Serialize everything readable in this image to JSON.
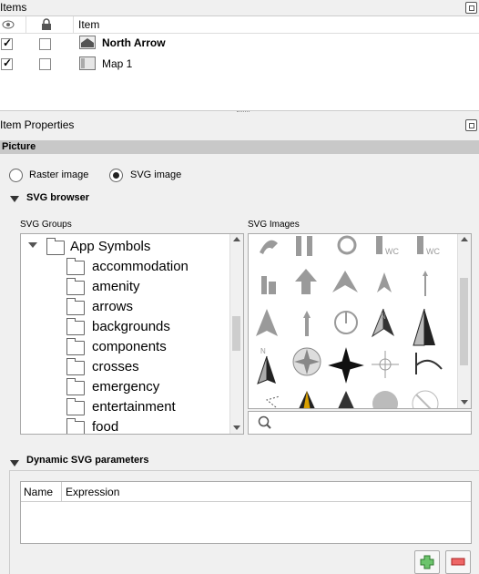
{
  "items_panel": {
    "title": "Items",
    "columns": {
      "visible_icon": "eye-icon",
      "lock_icon": "lock-icon",
      "item": "Item"
    },
    "rows": [
      {
        "label": "North Arrow",
        "visible": true,
        "locked": false,
        "icon": "picture-icon",
        "selected": true
      },
      {
        "label": "Map 1",
        "visible": true,
        "locked": false,
        "icon": "map-icon",
        "selected": false
      }
    ]
  },
  "props_panel": {
    "title": "Item Properties",
    "section": "Picture"
  },
  "picture": {
    "raster_label": "Raster image",
    "svg_label": "SVG image",
    "mode": "svg",
    "svg_browser_label": "SVG browser",
    "groups_label": "SVG Groups",
    "images_label": "SVG Images",
    "groups_root": "App Symbols",
    "groups": [
      "accommodation",
      "amenity",
      "arrows",
      "backgrounds",
      "components",
      "crosses",
      "emergency",
      "entertainment",
      "food"
    ],
    "search_placeholder": ""
  },
  "dynamic": {
    "title": "Dynamic SVG parameters",
    "col_name": "Name",
    "col_expression": "Expression",
    "add_icon": "add-icon",
    "remove_icon": "remove-icon"
  }
}
